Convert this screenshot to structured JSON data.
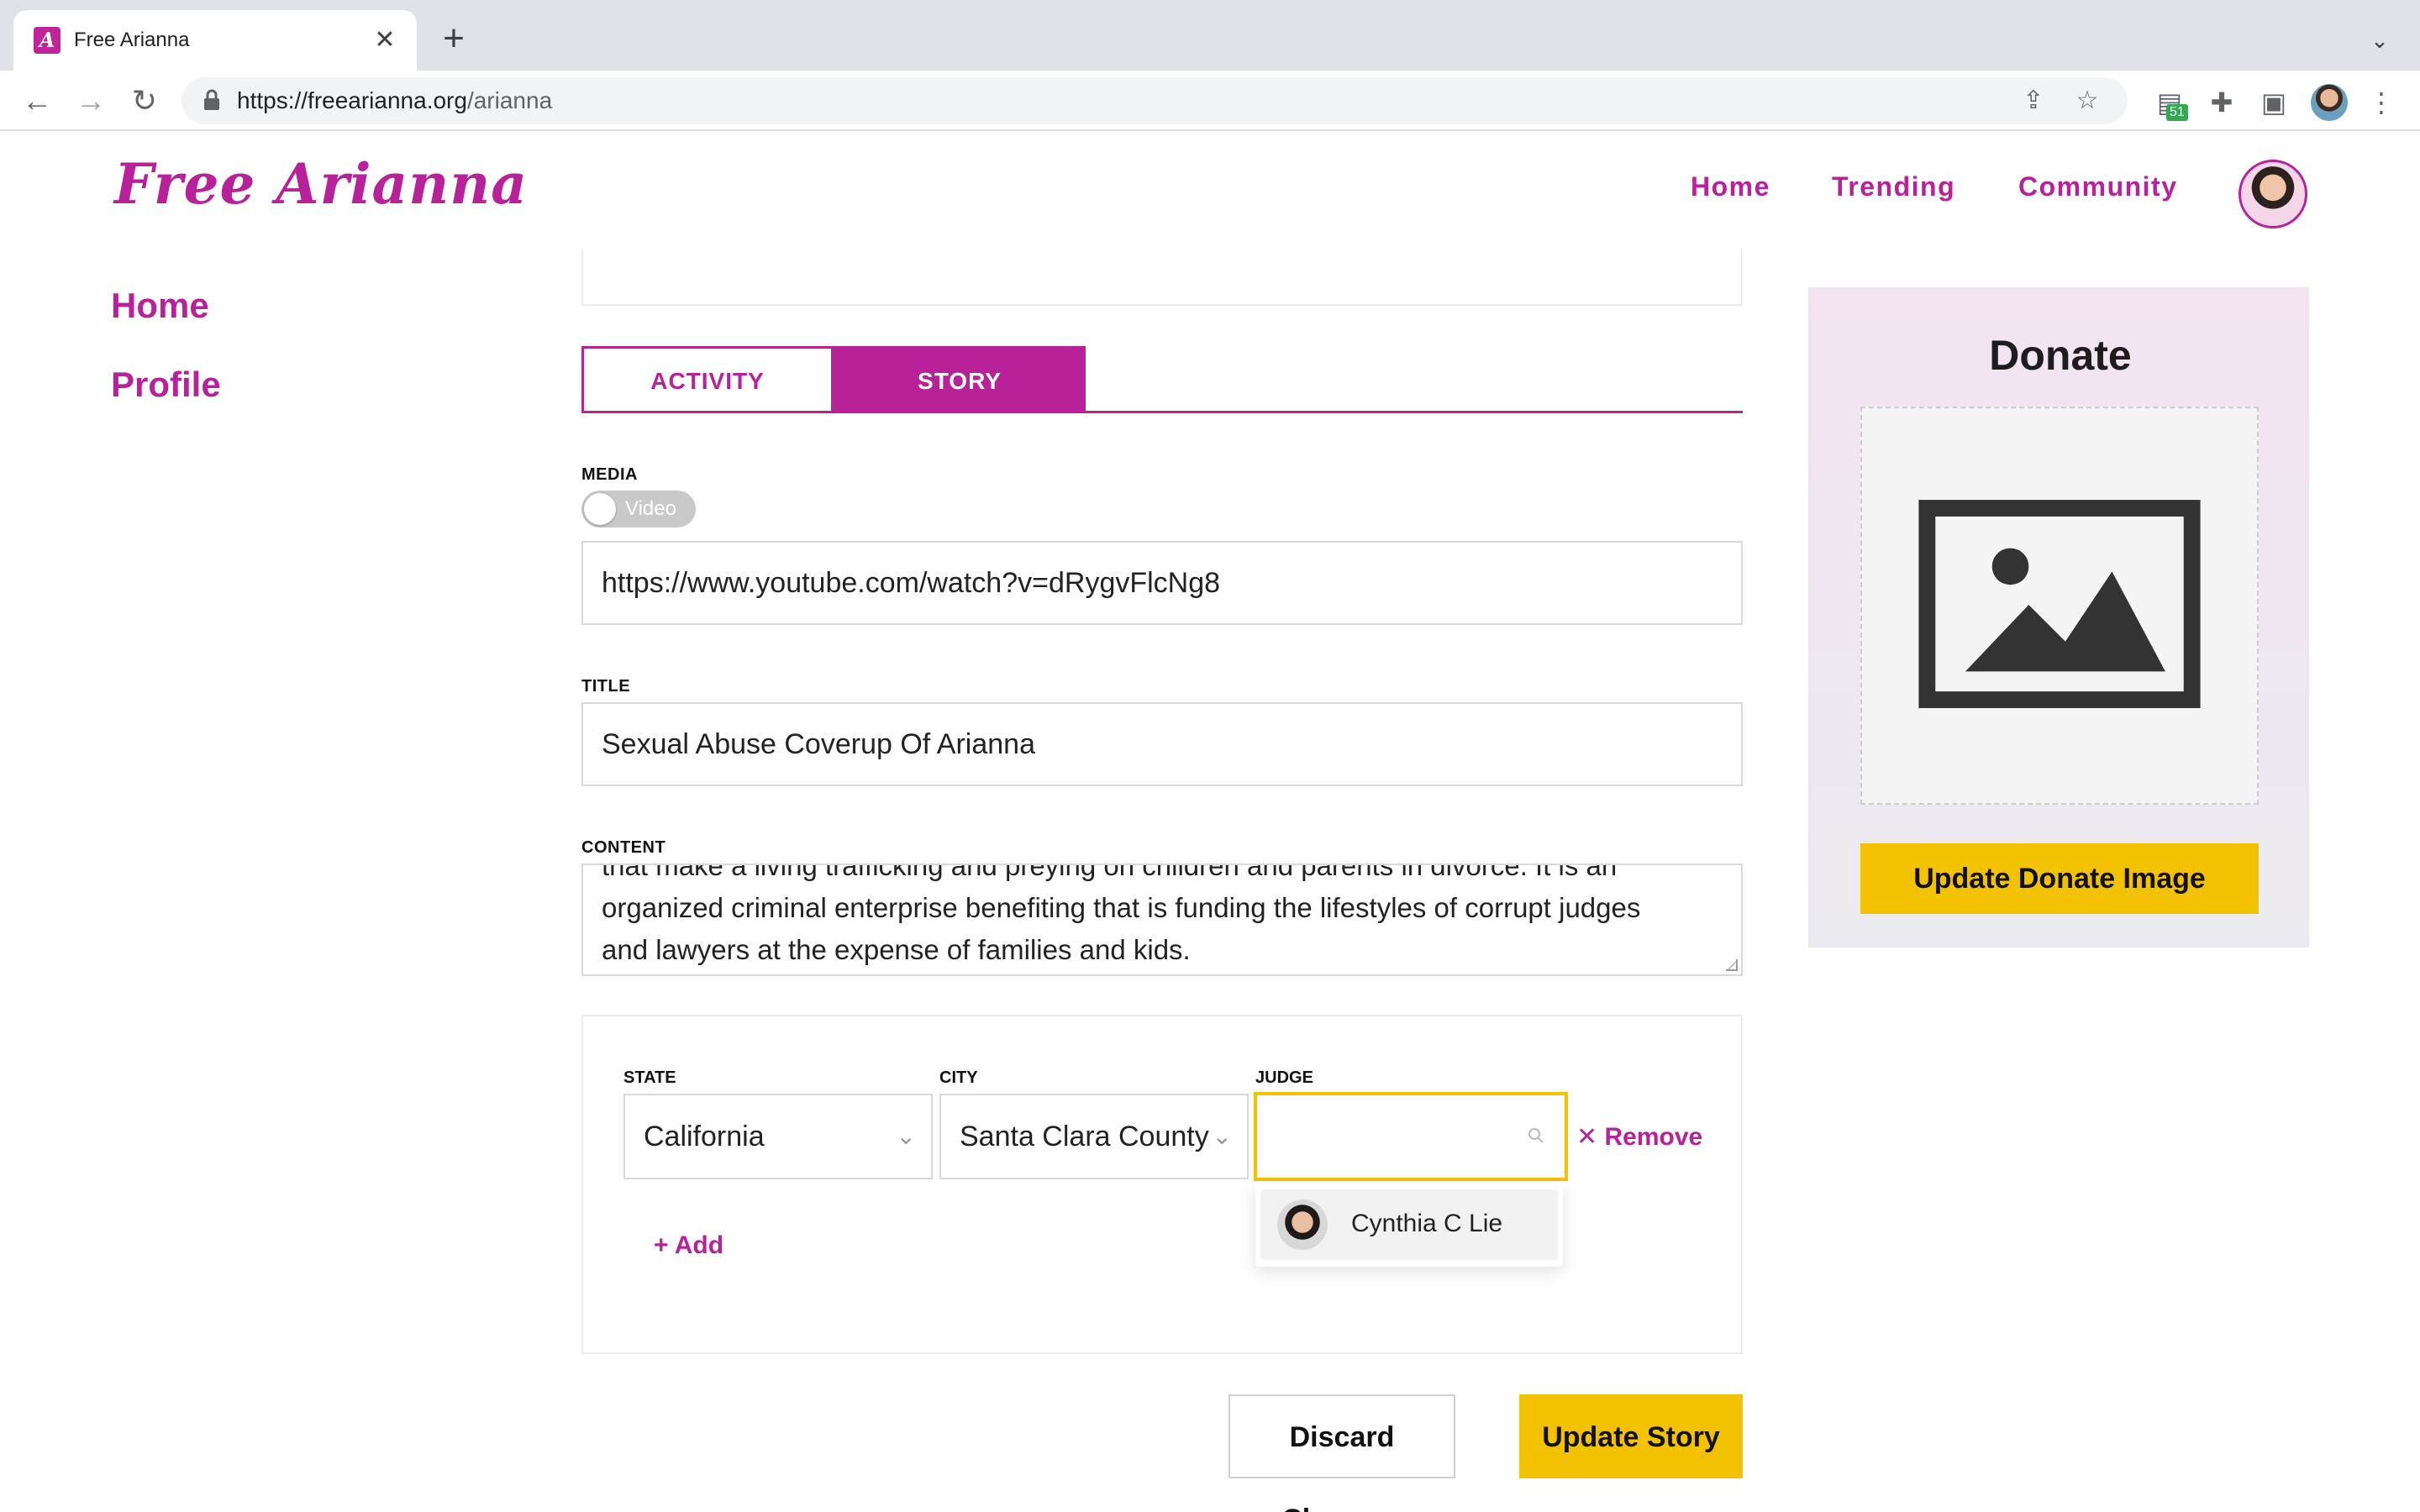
{
  "browser": {
    "tab_title": "Free Arianna",
    "tab_favicon_letter": "A",
    "url_domain": "https://freearianna.org",
    "url_path": "/arianna",
    "ext_badge": "51"
  },
  "header": {
    "logo": "Free Arianna",
    "nav": [
      {
        "label": "Home"
      },
      {
        "label": "Trending"
      },
      {
        "label": "Community"
      }
    ]
  },
  "sidebar": {
    "items": [
      {
        "label": "Home"
      },
      {
        "label": "Profile"
      }
    ]
  },
  "tabs": {
    "activity": "ACTIVITY",
    "story": "STORY",
    "active": "STORY"
  },
  "form": {
    "media_label": "MEDIA",
    "media_toggle_text": "Video",
    "media_url": "https://www.youtube.com/watch?v=dRygvFlcNg8",
    "title_label": "TITLE",
    "title_value": "Sexual Abuse Coverup Of Arianna",
    "content_label": "CONTENT",
    "content_lines": [
      "that make a living trafficking and preying on children and parents in divorce. It is an",
      "organized criminal enterprise benefiting that is funding the lifestyles of corrupt judges",
      "and lawyers at the expense of families and kids."
    ]
  },
  "location": {
    "state_label": "STATE",
    "state_value": "California",
    "city_label": "CITY",
    "city_value": "Santa Clara County",
    "judge_label": "JUDGE",
    "judge_value": "",
    "remove_label": "Remove",
    "add_label": "Add",
    "suggestions": [
      {
        "name": "Cynthia C Lie"
      }
    ]
  },
  "actions": {
    "discard": "Discard Changes",
    "update": "Update Story"
  },
  "donate": {
    "title": "Donate",
    "button": "Update Donate Image"
  },
  "colors": {
    "brand": "#b8219a",
    "accent": "#f2c200"
  }
}
